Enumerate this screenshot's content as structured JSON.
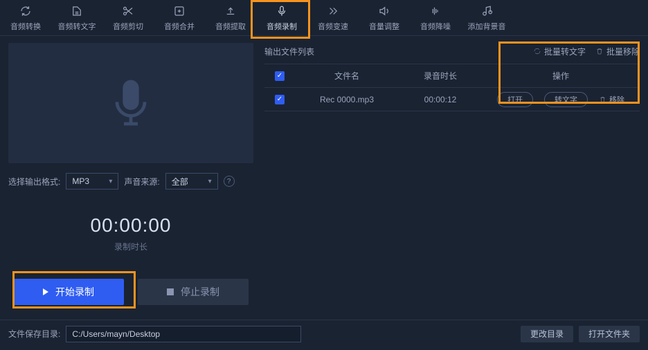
{
  "toolbar": {
    "items": [
      {
        "label": "音频转换"
      },
      {
        "label": "音频转文字"
      },
      {
        "label": "音频剪切"
      },
      {
        "label": "音频合并"
      },
      {
        "label": "音频提取"
      },
      {
        "label": "音频录制"
      },
      {
        "label": "音频变速"
      },
      {
        "label": "音量调整"
      },
      {
        "label": "音频降噪"
      },
      {
        "label": "添加背景音"
      }
    ]
  },
  "left": {
    "format_label": "选择输出格式:",
    "format_value": "MP3",
    "source_label": "声音来源:",
    "source_value": "全部",
    "timer": "00:00:00",
    "timer_label": "录制时长",
    "start_btn": "开始录制",
    "stop_btn": "停止录制"
  },
  "right": {
    "list_title": "输出文件列表",
    "batch_to_text": "批量转文字",
    "batch_remove": "批量移除",
    "headers": {
      "name": "文件名",
      "duration": "录音时长",
      "ops": "操作"
    },
    "row": {
      "name": "Rec 0000.mp3",
      "duration": "00:00:12",
      "open": "打开",
      "to_text": "转文字",
      "remove": "移除"
    }
  },
  "footer": {
    "path_label": "文件保存目录:",
    "path_value": "C:/Users/mayn/Desktop",
    "change_dir": "更改目录",
    "open_folder": "打开文件夹"
  }
}
